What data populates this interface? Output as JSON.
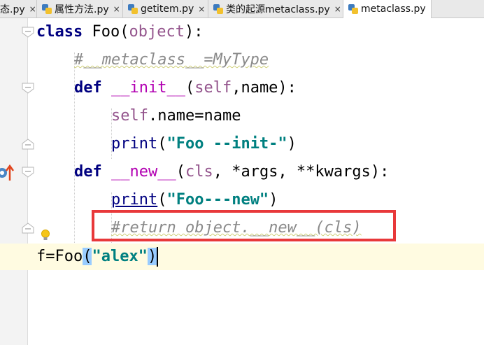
{
  "tabs": [
    {
      "label": "态.py",
      "active": false
    },
    {
      "label": "属性方法.py",
      "active": false
    },
    {
      "label": "getitem.py",
      "active": false
    },
    {
      "label": "类的起源metaclass.py",
      "active": false
    },
    {
      "label": "metaclass.py",
      "active": true
    }
  ],
  "tab_close_glyph": "×",
  "code": {
    "l1_kw": "class",
    "l1_rest_a": " Foo(",
    "l1_base": "object",
    "l1_rest_b": "):",
    "l2_comment": "#__metaclass__=MyType",
    "l3_kw": "def",
    "l3_name": "__init__",
    "l3_open": "(",
    "l3_self": "self",
    "l3_rest": ",name):",
    "l4_self": "self",
    "l4_rest": ".name=name",
    "l5_fn": "print",
    "l5_open": "(",
    "l5_str": "\"Foo --init-\"",
    "l5_close": ")",
    "l6_kw": "def",
    "l6_name": "__new__",
    "l6_open": "(",
    "l6_cls": "cls",
    "l6_rest": ", *args, **kwargs):",
    "l7_fn": "print",
    "l7_open": "(",
    "l7_str": "\"Foo---new\"",
    "l7_close": ")",
    "l8_comment": "#return object.__new__(cls)",
    "l9_a": "f=Foo",
    "l9_open": "(",
    "l9_str": "\"alex\"",
    "l9_close": ")"
  },
  "colors": {
    "keyword": "#000080",
    "string": "#008080",
    "comment": "#8a8a8a",
    "highlight_box": "#e8383a"
  },
  "icons": [
    "python-file-icon",
    "override-marker-icon",
    "bulb-icon"
  ]
}
